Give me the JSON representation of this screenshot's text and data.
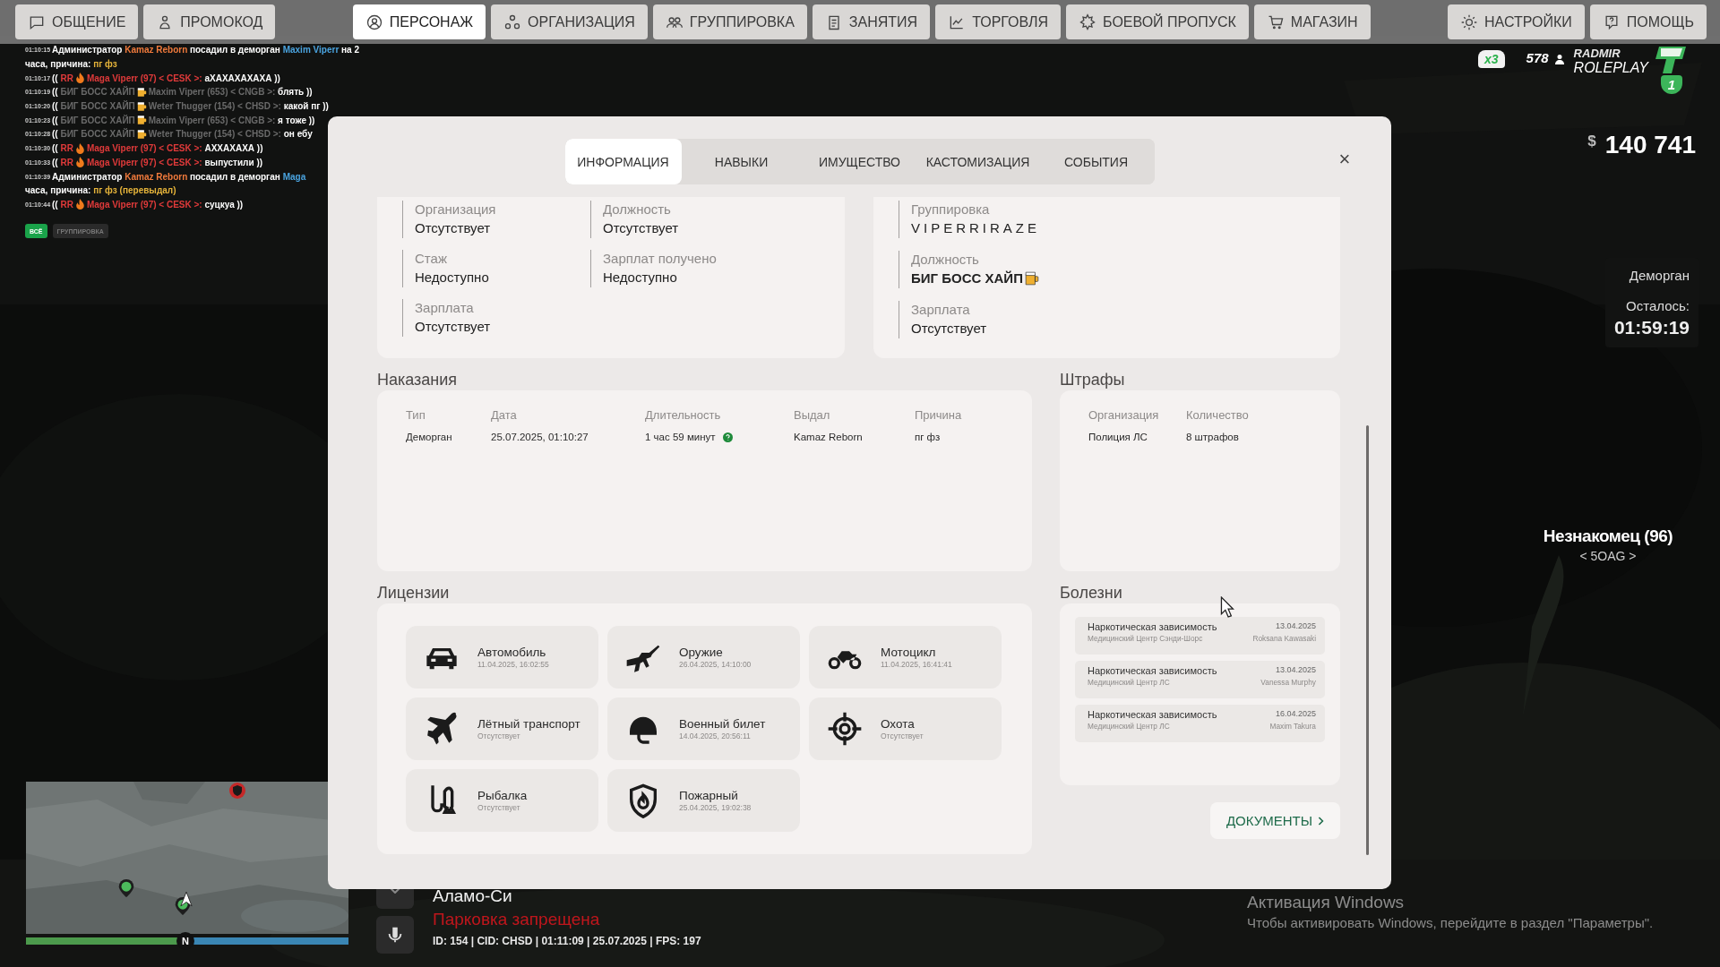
{
  "top_bar": {
    "left_buttons": [
      {
        "label": "ОБЩЕНИЕ"
      },
      {
        "label": "ПРОМОКОД"
      }
    ],
    "tabs": [
      {
        "label": "ПЕРСОНАЖ",
        "selected": true
      },
      {
        "label": "ОРГАНИЗАЦИЯ",
        "selected": false
      },
      {
        "label": "ГРУППИРОВКА",
        "selected": false
      },
      {
        "label": "ЗАНЯТИЯ",
        "selected": false
      },
      {
        "label": "ТОРГОВЛЯ",
        "selected": false
      },
      {
        "label": "БОЕВОЙ ПРОПУСК",
        "selected": false
      },
      {
        "label": "МАГАЗИН",
        "selected": false
      }
    ],
    "right_buttons": [
      {
        "label": "НАСТРОЙКИ"
      },
      {
        "label": "ПОМОЩЬ"
      }
    ]
  },
  "chat": {
    "messages": [
      {
        "time": "01:10:15",
        "lines": [
          [
            {
              "kind": "text",
              "text": "Администратор ",
              "color": "#ffffff"
            },
            {
              "kind": "text",
              "text": "Kamaz Reborn",
              "color": "#f07a3c"
            },
            {
              "kind": "text",
              "text": " посадил в деморган ",
              "color": "#ffffff"
            },
            {
              "kind": "text",
              "text": "Maxim Viperr",
              "color": "#4aa3df"
            },
            {
              "kind": "text",
              "text": " на 2",
              "color": "#ffffff"
            }
          ],
          [
            {
              "kind": "text",
              "text": "часа, причина: ",
              "color": "#ffffff"
            },
            {
              "kind": "text",
              "text": "пг фз",
              "color": "#e6b43a"
            }
          ]
        ]
      },
      {
        "time": "01:10:17",
        "lines": [
          [
            {
              "kind": "text",
              "text": "(( ",
              "color": "#ffffff"
            },
            {
              "kind": "text",
              "text": "RR",
              "color": "#e03a3a"
            },
            {
              "kind": "fire"
            },
            {
              "kind": "text",
              "text": "Maga Viperr (97) < CESK >:",
              "color": "#e03a3a"
            },
            {
              "kind": "text",
              "text": " аХАХАХАХАХА ))",
              "color": "#ffffff"
            }
          ]
        ]
      },
      {
        "time": "01:10:19",
        "lines": [
          [
            {
              "kind": "text",
              "text": "(( ",
              "color": "#ffffff"
            },
            {
              "kind": "text",
              "text": "БИГ БОСС ХАЙП",
              "color": "#6a6a6a"
            },
            {
              "kind": "mug"
            },
            {
              "kind": "text",
              "text": "Maxim Viperr (653) < CNGB >:",
              "color": "#6a6a6a"
            },
            {
              "kind": "text",
              "text": " блять ))",
              "color": "#ffffff"
            }
          ]
        ]
      },
      {
        "time": "01:10:20",
        "lines": [
          [
            {
              "kind": "text",
              "text": "(( ",
              "color": "#ffffff"
            },
            {
              "kind": "text",
              "text": "БИГ БОСС ХАЙП",
              "color": "#6a6a6a"
            },
            {
              "kind": "mug"
            },
            {
              "kind": "text",
              "text": "Weter Thugger (154) < CHSD >:",
              "color": "#6a6a6a"
            },
            {
              "kind": "text",
              "text": " какой пг ))",
              "color": "#ffffff"
            }
          ]
        ]
      },
      {
        "time": "01:10:23",
        "lines": [
          [
            {
              "kind": "text",
              "text": "(( ",
              "color": "#ffffff"
            },
            {
              "kind": "text",
              "text": "БИГ БОСС ХАЙП",
              "color": "#6a6a6a"
            },
            {
              "kind": "mug"
            },
            {
              "kind": "text",
              "text": "Maxim Viperr (653) < CNGB >:",
              "color": "#6a6a6a"
            },
            {
              "kind": "text",
              "text": " я тоже ))",
              "color": "#ffffff"
            }
          ]
        ]
      },
      {
        "time": "01:10:28",
        "lines": [
          [
            {
              "kind": "text",
              "text": "(( ",
              "color": "#ffffff"
            },
            {
              "kind": "text",
              "text": "БИГ БОСС ХАЙП",
              "color": "#6a6a6a"
            },
            {
              "kind": "mug"
            },
            {
              "kind": "text",
              "text": "Weter Thugger (154) < CHSD >:",
              "color": "#6a6a6a"
            },
            {
              "kind": "text",
              "text": " он ебу",
              "color": "#ffffff"
            }
          ]
        ]
      },
      {
        "time": "01:10:30",
        "lines": [
          [
            {
              "kind": "text",
              "text": "(( ",
              "color": "#ffffff"
            },
            {
              "kind": "text",
              "text": "RR",
              "color": "#e03a3a"
            },
            {
              "kind": "fire"
            },
            {
              "kind": "text",
              "text": "Maga Viperr (97) < CESK >:",
              "color": "#e03a3a"
            },
            {
              "kind": "text",
              "text": " АХХАХАХА ))",
              "color": "#ffffff"
            }
          ]
        ]
      },
      {
        "time": "01:10:33",
        "lines": [
          [
            {
              "kind": "text",
              "text": "(( ",
              "color": "#ffffff"
            },
            {
              "kind": "text",
              "text": "RR",
              "color": "#e03a3a"
            },
            {
              "kind": "fire"
            },
            {
              "kind": "text",
              "text": "Maga Viperr (97) < CESK >:",
              "color": "#e03a3a"
            },
            {
              "kind": "text",
              "text": " выпустили ))",
              "color": "#ffffff"
            }
          ]
        ]
      },
      {
        "time": "01:10:39",
        "lines": [
          [
            {
              "kind": "text",
              "text": "Администратор ",
              "color": "#ffffff"
            },
            {
              "kind": "text",
              "text": "Kamaz Reborn",
              "color": "#f07a3c"
            },
            {
              "kind": "text",
              "text": " посадил в деморган ",
              "color": "#ffffff"
            },
            {
              "kind": "text",
              "text": "Maga",
              "color": "#4aa3df"
            }
          ],
          [
            {
              "kind": "text",
              "text": "часа, причина: ",
              "color": "#ffffff"
            },
            {
              "kind": "text",
              "text": "пг фз (перевыдал)",
              "color": "#e6b43a"
            }
          ]
        ]
      },
      {
        "time": "01:10:44",
        "lines": [
          [
            {
              "kind": "text",
              "text": "(( ",
              "color": "#ffffff"
            },
            {
              "kind": "text",
              "text": "RR",
              "color": "#e03a3a"
            },
            {
              "kind": "fire"
            },
            {
              "kind": "text",
              "text": "Maga Viperr (97) < CESK >:",
              "color": "#e03a3a"
            },
            {
              "kind": "text",
              "text": " суцкуа ))",
              "color": "#ffffff"
            }
          ]
        ]
      }
    ],
    "filters": [
      {
        "label": "ВСЁ",
        "selected": true
      },
      {
        "label": "ГРУППИРОВКА",
        "selected": false
      }
    ]
  },
  "character": {
    "tabs": [
      {
        "label": "ИНФОРМАЦИЯ",
        "selected": true
      },
      {
        "label": "НАВЫКИ",
        "selected": false
      },
      {
        "label": "ИМУЩЕСТВО",
        "selected": false
      },
      {
        "label": "КАСТОМИЗАЦИЯ",
        "selected": false
      },
      {
        "label": "СОБЫТИЯ",
        "selected": false
      }
    ],
    "close": "×",
    "organization": [
      {
        "label": "Организация",
        "value": "Отсутствует"
      },
      {
        "label": "Должность",
        "value": "Отсутствует"
      },
      {
        "label": "Стаж",
        "value": "Недоступно"
      },
      {
        "label": "Зарплат получено",
        "value": "Недоступно"
      },
      {
        "label": "Зарплата",
        "value": "Отсутствует"
      }
    ],
    "gang": [
      {
        "label": "Группировка",
        "value": "VIPERRIRAZE",
        "kind": "spaced"
      },
      {
        "label": "Должность",
        "value": "БИГ БОСС ХАЙП",
        "kind": "rank"
      },
      {
        "label": "Зарплата",
        "value": "Отсутствует",
        "kind": "plain"
      }
    ],
    "punishments": {
      "title": "Наказания",
      "columns": [
        "Тип",
        "Дата",
        "Длительность",
        "Выдал",
        "Причина"
      ],
      "rows": [
        {
          "cells": [
            {
              "text": "Деморган",
              "info": false
            },
            {
              "text": "25.07.2025, 01:10:27",
              "info": false
            },
            {
              "text": "1 час 59 минут",
              "info": true
            },
            {
              "text": "Kamaz Reborn",
              "info": false
            },
            {
              "text": "пг фз",
              "info": false
            }
          ]
        }
      ]
    },
    "fines": {
      "title": "Штрафы",
      "columns": [
        "Организация",
        "Количество"
      ],
      "rows": [
        {
          "cells": [
            "Полиция ЛС",
            "8 штрафов"
          ]
        }
      ]
    },
    "licenses": {
      "title": "Лицензии",
      "items": [
        {
          "name": "Автомобиль",
          "date": "11.04.2025, 16:02:55"
        },
        {
          "name": "Оружие",
          "date": "26.04.2025, 14:10:00"
        },
        {
          "name": "Мотоцикл",
          "date": "11.04.2025, 16:41:41"
        },
        {
          "name": "Лётный транспорт",
          "date": "Отсутствует"
        },
        {
          "name": "Военный билет",
          "date": "14.04.2025, 20:56:11"
        },
        {
          "name": "Охота",
          "date": "Отсутствует"
        },
        {
          "name": "Рыбалка",
          "date": "Отсутствует"
        },
        {
          "name": "Пожарный",
          "date": "25.04.2025, 19:02:38"
        }
      ]
    },
    "diseases": {
      "title": "Болезни",
      "items": [
        {
          "name": "Наркотическая зависимость",
          "date": "13.04.2025",
          "clinic": "Медицинский Центр Сэнди-Шорс",
          "doctor": "Roksana Kawasaki"
        },
        {
          "name": "Наркотическая зависимость",
          "date": "13.04.2025",
          "clinic": "Медицинский Центр ЛС",
          "doctor": "Vanessa Murphy"
        },
        {
          "name": "Наркотическая зависимость",
          "date": "16.04.2025",
          "clinic": "Медицинский Центр ЛС",
          "doctor": "Maxim Takura"
        }
      ]
    },
    "documents_button": "ДОКУМЕНТЫ"
  },
  "server": {
    "multiplier": "x3",
    "online": "578",
    "logo_top": "RADMIR",
    "logo_bottom": "ROLEPLAY",
    "badge": "1"
  },
  "money": {
    "currency": "$",
    "amount": "140 741"
  },
  "jail": {
    "title": "Деморган",
    "label": "Осталось:",
    "time": "01:59:19"
  },
  "player_tag": {
    "name": "Незнакомец (96)",
    "tag": "< 5OAG >"
  },
  "minimap": {
    "compass": "N"
  },
  "location": {
    "area": "Аламо-Си",
    "zone_status": "Парковка запрещена",
    "info": "ID: 154 | CID: CHSD | 01:11:09 | 25.07.2025 | FPS: 197"
  },
  "windows_notice": {
    "title": "Активация Windows",
    "text": "Чтобы активировать Windows, перейдите в раздел \"Параметры\"."
  }
}
